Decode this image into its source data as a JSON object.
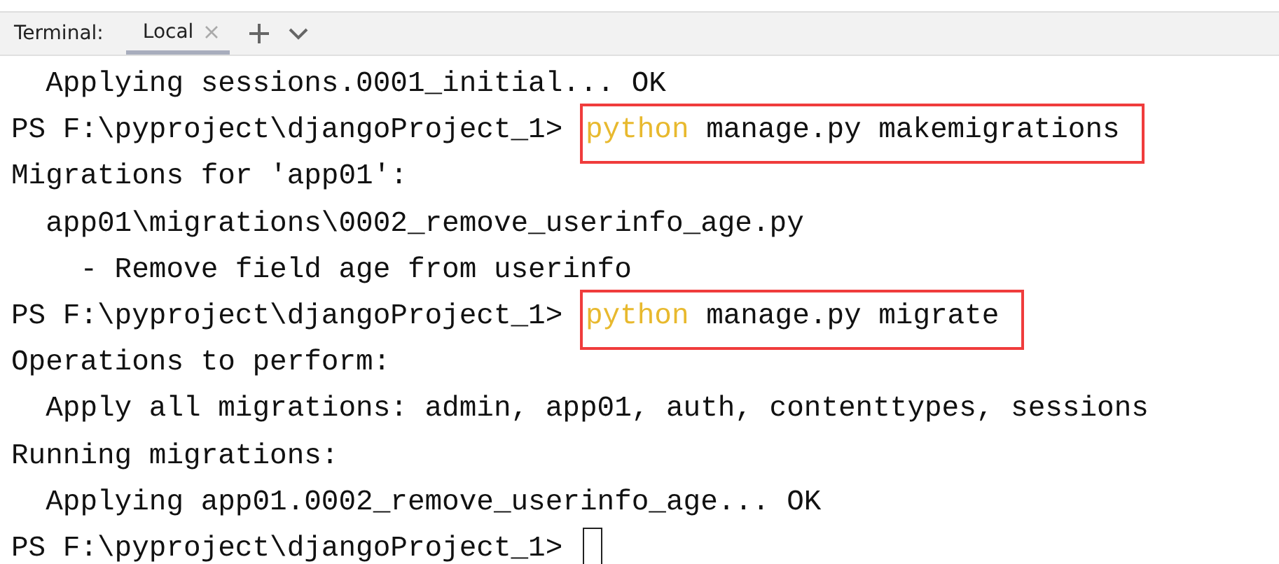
{
  "tab_bar": {
    "label": "Terminal:",
    "tabs": [
      {
        "label": "Local",
        "selected": true
      }
    ]
  },
  "lines": [
    {
      "kind": "output",
      "text": "  Applying sessions.0001_initial... OK"
    },
    {
      "kind": "prompt",
      "prompt": "PS F:\\pyproject\\djangoProject_1> ",
      "program": "python",
      "args": " manage.py makemigrations",
      "highlighted": true
    },
    {
      "kind": "output",
      "text": "Migrations for 'app01':"
    },
    {
      "kind": "output",
      "text": "  app01\\migrations\\0002_remove_userinfo_age.py"
    },
    {
      "kind": "output",
      "text": "    - Remove field age from userinfo"
    },
    {
      "kind": "prompt",
      "prompt": "PS F:\\pyproject\\djangoProject_1> ",
      "program": "python",
      "args": " manage.py migrate",
      "highlighted": true
    },
    {
      "kind": "output",
      "text": "Operations to perform:"
    },
    {
      "kind": "output",
      "text": "  Apply all migrations: admin, app01, auth, contenttypes, sessions"
    },
    {
      "kind": "output",
      "text": "Running migrations:"
    },
    {
      "kind": "output",
      "text": "  Applying app01.0002_remove_userinfo_age... OK"
    },
    {
      "kind": "prompt",
      "prompt": "PS F:\\pyproject\\djangoProject_1> ",
      "cursor": true
    }
  ]
}
